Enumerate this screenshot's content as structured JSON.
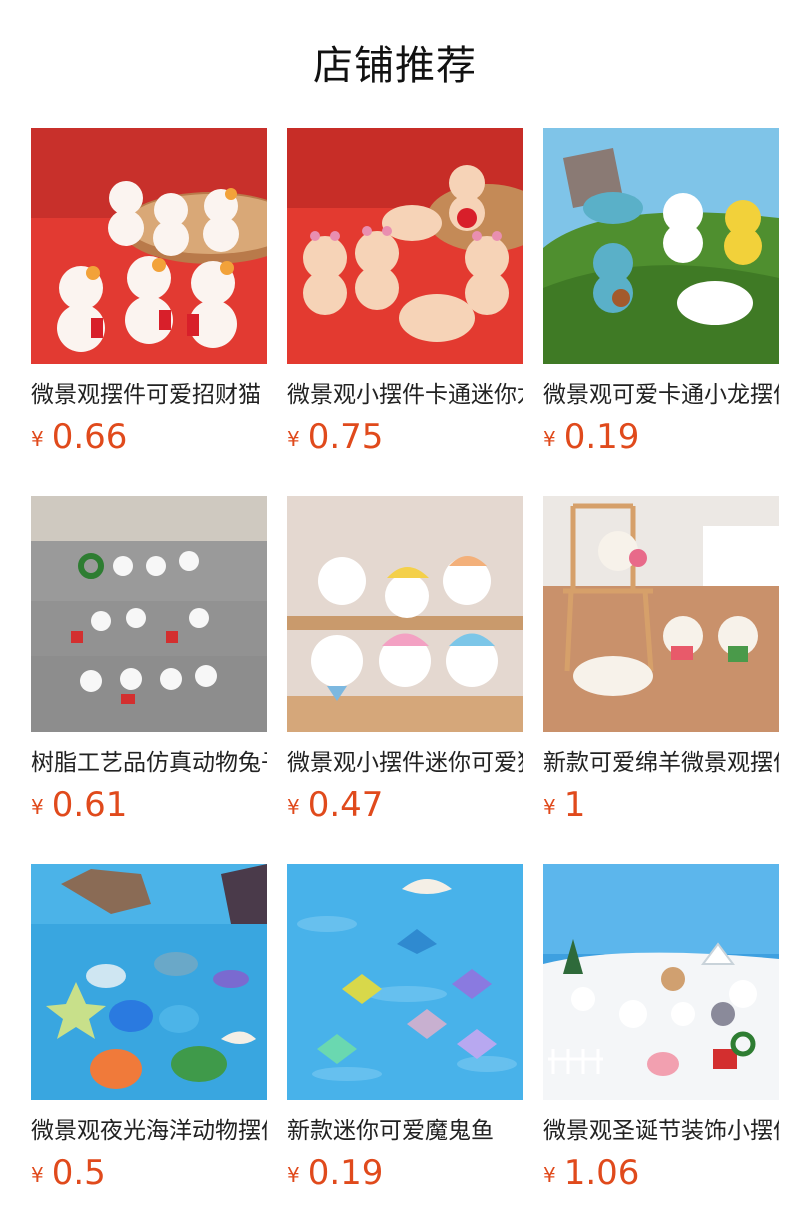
{
  "page": {
    "title": "店铺推荐"
  },
  "currency_symbol": "¥",
  "products": [
    {
      "name": "微景观摆件可爱招财猫",
      "price": "0.66",
      "image": "lucky-cat-figurines-on-red"
    },
    {
      "name": "微景观小摆件卡通迷你龙",
      "price": "0.75",
      "image": "dragon-figurines-on-red"
    },
    {
      "name": "微景观可爱卡通小龙摆件",
      "price": "0.19",
      "image": "dragon-figurines-on-grass"
    },
    {
      "name": "树脂工艺品仿真动物兔子",
      "price": "0.61",
      "image": "rabbit-figurines-on-gray"
    },
    {
      "name": "微景观小摆件迷你可爱狗",
      "price": "0.47",
      "image": "dog-figurines-on-shelf"
    },
    {
      "name": "新款可爱绵羊微景观摆件",
      "price": "1",
      "image": "sheep-figurines-with-chair"
    },
    {
      "name": "微景观夜光海洋动物摆件",
      "price": "0.5",
      "image": "ocean-animal-figurines"
    },
    {
      "name": "新款迷你可爱魔鬼鱼",
      "price": "0.19",
      "image": "manta-ray-figurines-in-water"
    },
    {
      "name": "微景观圣诞节装饰小摆件",
      "price": "1.06",
      "image": "christmas-figurines-in-snow"
    }
  ],
  "colors": {
    "price": "#e04a1c",
    "title": "#111111",
    "name": "#222222"
  }
}
